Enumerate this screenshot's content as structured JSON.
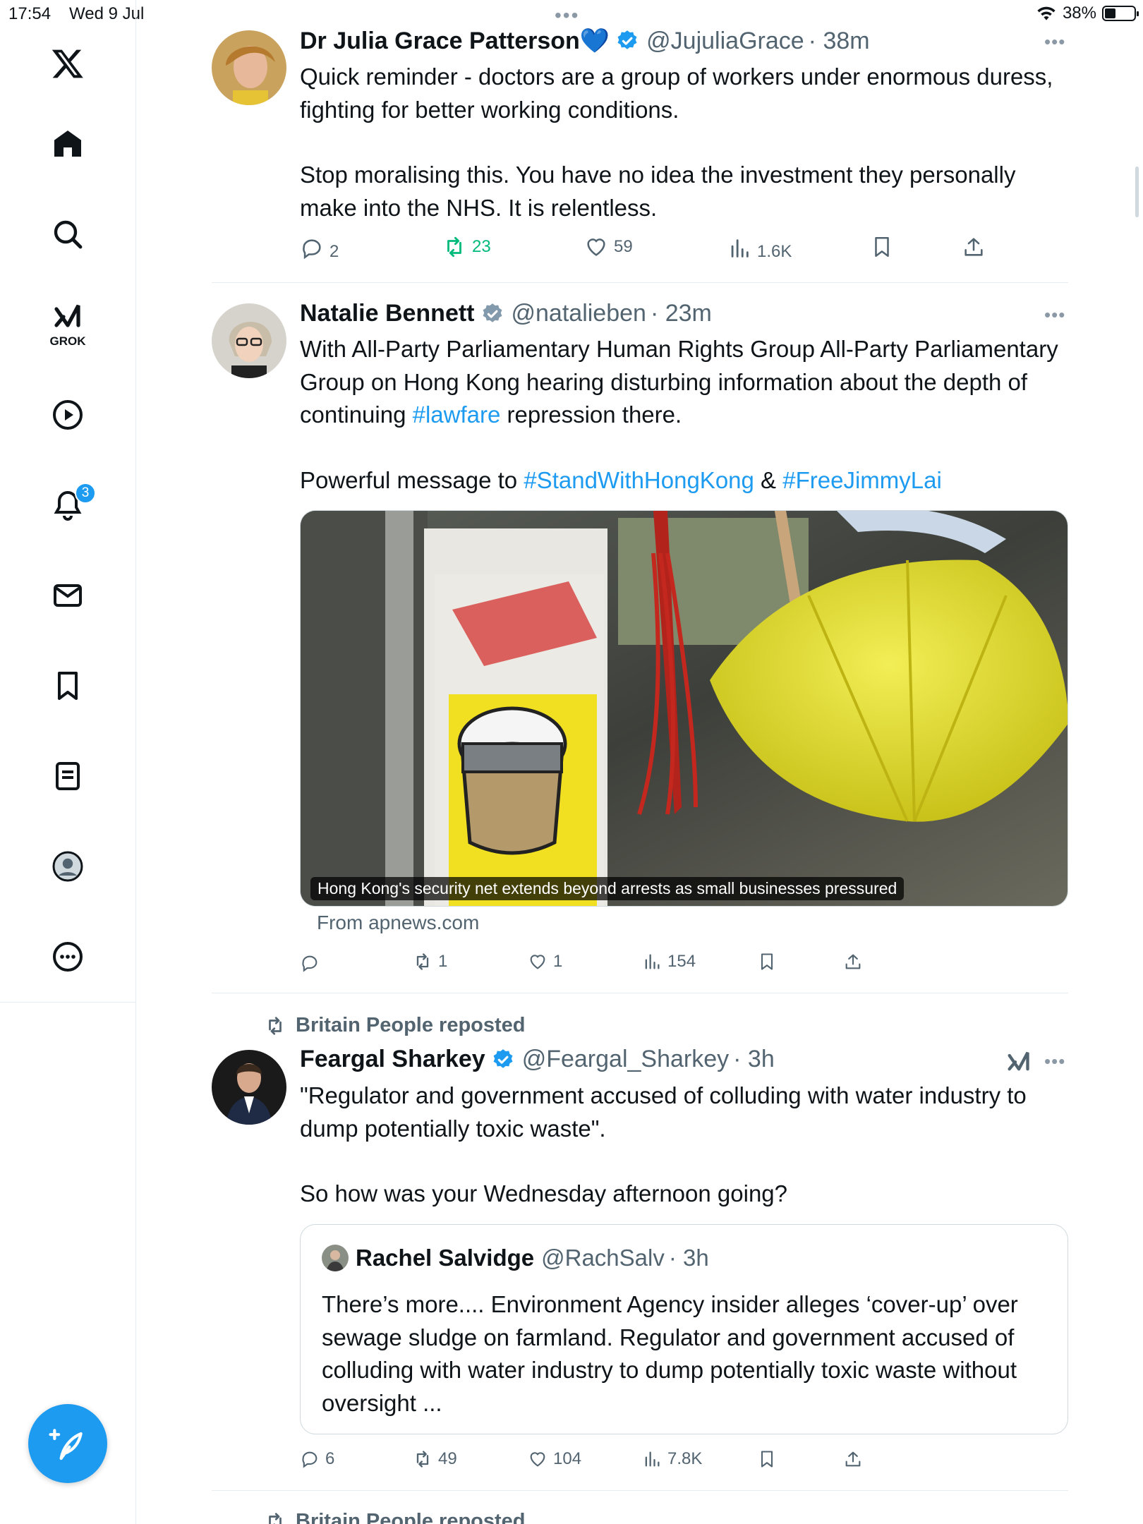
{
  "status_bar": {
    "time": "17:54",
    "date": "Wed 9 Jul",
    "battery": "38%",
    "battery_level": 0.38
  },
  "sidebar": {
    "items": [
      {
        "icon": "x-logo-icon"
      },
      {
        "icon": "home-icon"
      },
      {
        "icon": "search-icon"
      },
      {
        "icon": "grok-icon",
        "label": "GROK"
      },
      {
        "icon": "video-play-icon"
      },
      {
        "icon": "notifications-bell-icon",
        "badge": "3"
      },
      {
        "icon": "messages-envelope-icon"
      },
      {
        "icon": "bookmarks-icon"
      },
      {
        "icon": "lists-icon"
      },
      {
        "icon": "profile-icon"
      },
      {
        "icon": "more-circle-icon"
      }
    ],
    "compose_icon": "compose-feather-icon"
  },
  "colors": {
    "accent": "#1d9bf0",
    "repost_green": "#00ba7c",
    "muted": "#536471"
  },
  "tweets": [
    {
      "name": "Dr Julia Grace Patterson💙",
      "handle": "@JujuliaGrace",
      "time": "· 38m",
      "text_1": "Quick reminder - doctors are a group of workers under enormous duress, fighting for better working conditions.",
      "text_2": "Stop moralising this. You have no idea the investment they personally make into the NHS. It is relentless.",
      "replies": "2",
      "reposts": "23",
      "likes": "59",
      "views": "1.6K"
    },
    {
      "name": "Natalie Bennett",
      "handle": "@natalieben",
      "time": "· 23m",
      "text_1a": "With All-Party Parliamentary Human Rights Group All-Party Parliamentary Group on Hong Kong hearing disturbing information about the depth of continuing ",
      "hashtag_1": "#lawfare",
      "text_1b": " repression there.",
      "text_2a": "Powerful message to ",
      "hashtag_2": "#StandWithHongKong",
      "text_2b": " & ",
      "hashtag_3": "#FreeJimmyLai",
      "media_caption": "Hong Kong's security net extends beyond arrests as small businesses pressured",
      "source": "From apnews.com",
      "reposts": "1",
      "likes": "1",
      "views": "154"
    },
    {
      "repost_context": "Britain People reposted",
      "name": "Feargal Sharkey",
      "handle": "@Feargal_Sharkey",
      "time": "· 3h",
      "text_1": "\"Regulator and government accused of colluding with water industry to dump potentially toxic waste\".",
      "text_2": "So how was your Wednesday afternoon going?",
      "quote": {
        "name": "Rachel Salvidge",
        "handle": "@RachSalv",
        "time": "· 3h",
        "text": "There’s more.... Environment Agency insider alleges ‘cover-up’ over sewage sludge on farmland. Regulator and government accused of colluding with water industry to dump potentially toxic waste without oversight ..."
      },
      "replies": "6",
      "reposts": "49",
      "likes": "104",
      "views": "7.8K"
    },
    {
      "repost_context": "Britain People reposted"
    }
  ]
}
